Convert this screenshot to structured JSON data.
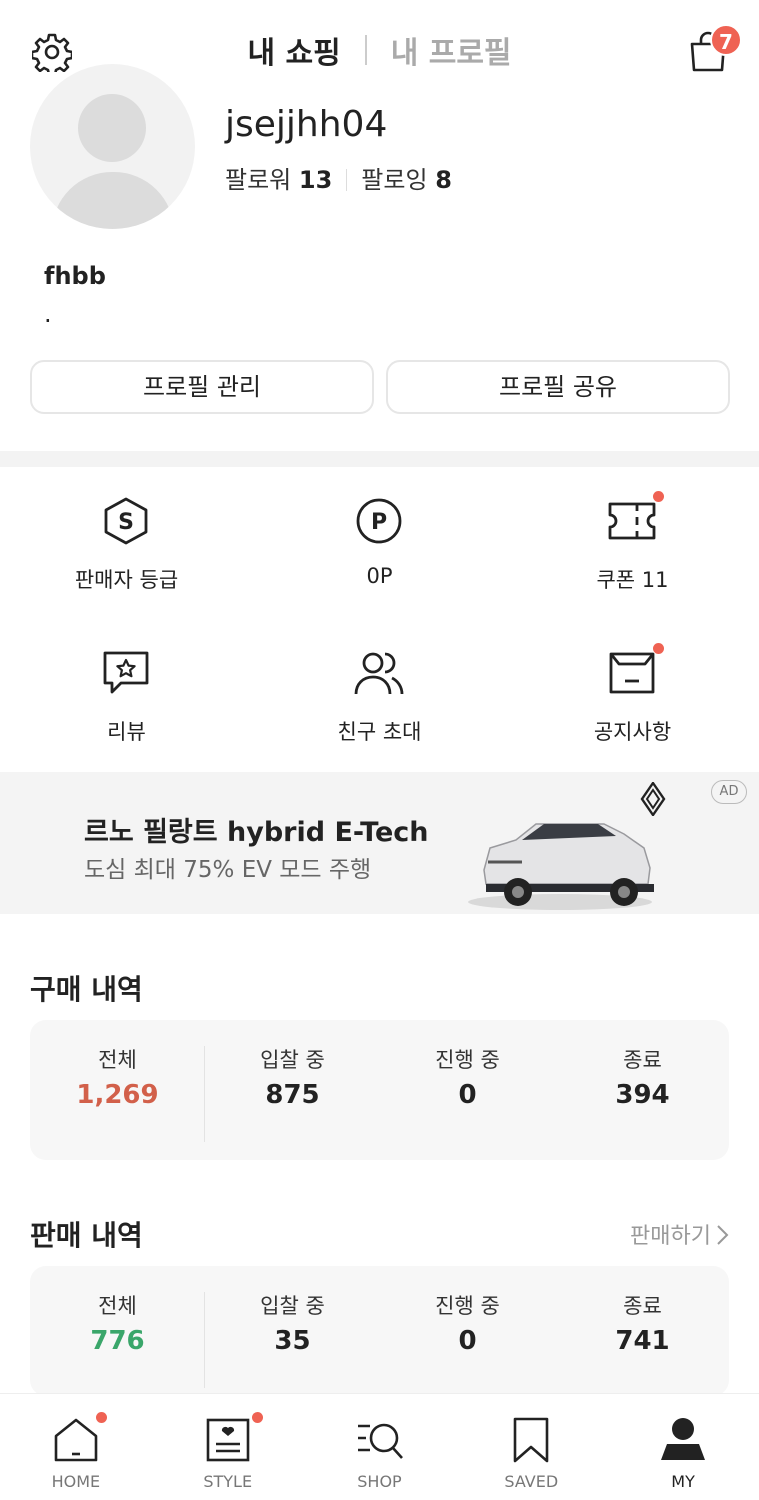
{
  "header": {
    "tab_active": "내 쇼핑",
    "tab_inactive": "내 프로필",
    "cart_count": "7"
  },
  "profile": {
    "username": "jsejjhh04",
    "followers_label": "팔로워",
    "followers_count": "13",
    "following_label": "팔로잉",
    "following_count": "8",
    "bio_name": "fhbb",
    "bio_text": ".",
    "manage_button": "프로필 관리",
    "share_button": "프로필 공유"
  },
  "menu": {
    "seller_grade": "판매자 등급",
    "points": "0P",
    "coupons": "쿠폰 11",
    "reviews": "리뷰",
    "invite": "친구 초대",
    "notices": "공지사항"
  },
  "ad": {
    "title": "르노 필랑트 hybrid E-Tech",
    "subtitle": "도심 최대 75% EV 모드 주행",
    "badge": "AD"
  },
  "purchase": {
    "title": "구매 내역",
    "stats": [
      {
        "label": "전체",
        "value": "1,269"
      },
      {
        "label": "입찰 중",
        "value": "875"
      },
      {
        "label": "진행 중",
        "value": "0"
      },
      {
        "label": "종료",
        "value": "394"
      }
    ]
  },
  "sales": {
    "title": "판매 내역",
    "link": "판매하기",
    "stats": [
      {
        "label": "전체",
        "value": "776"
      },
      {
        "label": "입찰 중",
        "value": "35"
      },
      {
        "label": "진행 중",
        "value": "0"
      },
      {
        "label": "종료",
        "value": "741"
      }
    ]
  },
  "nav": {
    "home": "HOME",
    "style": "STYLE",
    "shop": "SHOP",
    "saved": "SAVED",
    "my": "MY"
  },
  "colors": {
    "accent_red": "#ef6253",
    "purchase_total": "#d2604a",
    "sales_total": "#3aa66a"
  }
}
